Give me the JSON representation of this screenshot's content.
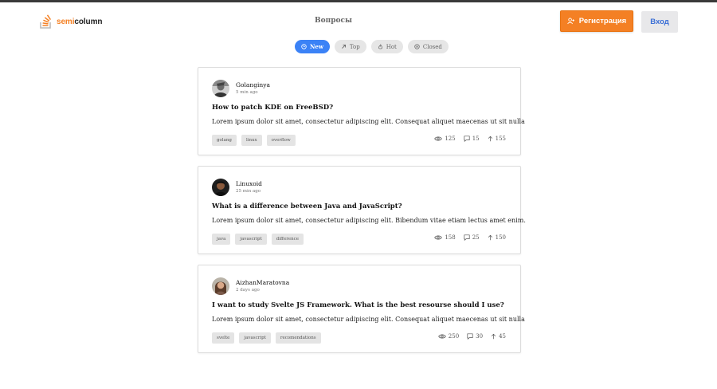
{
  "brand": {
    "name_part1": "semi",
    "name_part2": "column",
    "icon": "stack-logo-icon",
    "accent": "#f48024"
  },
  "nav": {
    "title": "Вопросы"
  },
  "header": {
    "register_label": "Регистрация",
    "register_icon": "user-add-icon",
    "login_label": "Вход"
  },
  "filters": [
    {
      "label": "New",
      "icon": "clock-icon",
      "active": true
    },
    {
      "label": "Top",
      "icon": "arrow-up-right-icon",
      "active": false
    },
    {
      "label": "Hot",
      "icon": "flame-icon",
      "active": false
    },
    {
      "label": "Closed",
      "icon": "close-circle-icon",
      "active": false
    }
  ],
  "questions": [
    {
      "author": "Golanginya",
      "time": "5 min ago",
      "title": "How to patch KDE on FreeBSD?",
      "text": "Lorem ipsum dolor sit amet, consectetur adipiscing elit. Consequat aliquet maecenas ut sit nulla",
      "tags": [
        "golang",
        "linux",
        "overflow"
      ],
      "views": "125",
      "comments": "15",
      "votes": "155"
    },
    {
      "author": "Linuxoid",
      "time": "25 min ago",
      "title": "What is a difference between Java and JavaScript?",
      "text": "Lorem ipsum dolor sit amet, consectetur adipiscing elit. Bibendum vitae etiam lectus amet enim.",
      "tags": [
        "java",
        "javascript",
        "difference"
      ],
      "views": "158",
      "comments": "25",
      "votes": "150"
    },
    {
      "author": "AizhanMaratovna",
      "time": "2 days ago",
      "title": "I want to study Svelte JS Framework. What is the best resourse should I use?",
      "text": "Lorem ipsum dolor sit amet, consectetur adipiscing elit. Consequat aliquet maecenas ut sit nulla",
      "tags": [
        "svelte",
        "javascript",
        "recomendations"
      ],
      "views": "250",
      "comments": "30",
      "votes": "45"
    }
  ]
}
